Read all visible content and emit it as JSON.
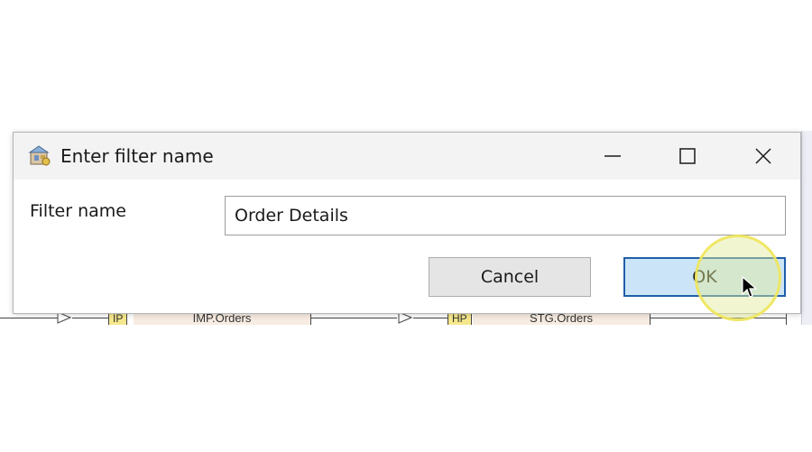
{
  "dialog": {
    "title": "Enter filter name",
    "app_icon": "app-icon",
    "controls": {
      "minimize_icon": "minimize-icon",
      "maximize_icon": "maximize-icon",
      "close_icon": "close-icon"
    },
    "field_label": "Filter name",
    "field_value": "Order Details",
    "cancel_label": "Cancel",
    "ok_label": "OK"
  },
  "background": {
    "nodes": [
      {
        "tag": "IP",
        "label": "IMP.Orders"
      },
      {
        "tag": "HP",
        "label": "STG.Orders"
      }
    ]
  },
  "colors": {
    "ok_fill": "#cce4f7",
    "ok_border": "#1f5fa8",
    "node_fill": "#f7ece2",
    "tag_fill": "#f5e88c",
    "cursor_halo": "#f0e65a"
  }
}
